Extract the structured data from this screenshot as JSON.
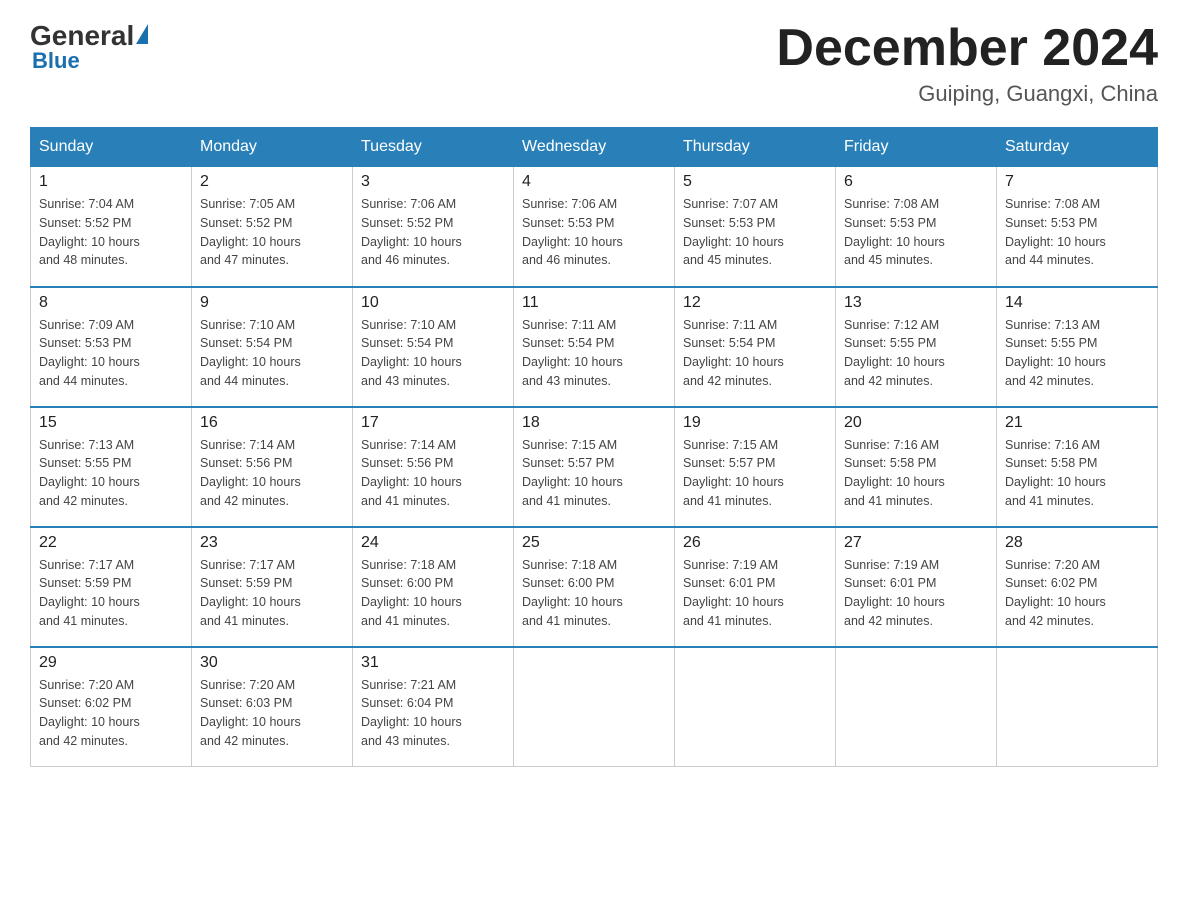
{
  "header": {
    "logo": {
      "general": "General",
      "blue": "Blue"
    },
    "title": "December 2024",
    "location": "Guiping, Guangxi, China"
  },
  "days_of_week": [
    "Sunday",
    "Monday",
    "Tuesday",
    "Wednesday",
    "Thursday",
    "Friday",
    "Saturday"
  ],
  "weeks": [
    [
      {
        "day": 1,
        "sunrise": "7:04 AM",
        "sunset": "5:52 PM",
        "daylight": "10 hours and 48 minutes."
      },
      {
        "day": 2,
        "sunrise": "7:05 AM",
        "sunset": "5:52 PM",
        "daylight": "10 hours and 47 minutes."
      },
      {
        "day": 3,
        "sunrise": "7:06 AM",
        "sunset": "5:52 PM",
        "daylight": "10 hours and 46 minutes."
      },
      {
        "day": 4,
        "sunrise": "7:06 AM",
        "sunset": "5:53 PM",
        "daylight": "10 hours and 46 minutes."
      },
      {
        "day": 5,
        "sunrise": "7:07 AM",
        "sunset": "5:53 PM",
        "daylight": "10 hours and 45 minutes."
      },
      {
        "day": 6,
        "sunrise": "7:08 AM",
        "sunset": "5:53 PM",
        "daylight": "10 hours and 45 minutes."
      },
      {
        "day": 7,
        "sunrise": "7:08 AM",
        "sunset": "5:53 PM",
        "daylight": "10 hours and 44 minutes."
      }
    ],
    [
      {
        "day": 8,
        "sunrise": "7:09 AM",
        "sunset": "5:53 PM",
        "daylight": "10 hours and 44 minutes."
      },
      {
        "day": 9,
        "sunrise": "7:10 AM",
        "sunset": "5:54 PM",
        "daylight": "10 hours and 44 minutes."
      },
      {
        "day": 10,
        "sunrise": "7:10 AM",
        "sunset": "5:54 PM",
        "daylight": "10 hours and 43 minutes."
      },
      {
        "day": 11,
        "sunrise": "7:11 AM",
        "sunset": "5:54 PM",
        "daylight": "10 hours and 43 minutes."
      },
      {
        "day": 12,
        "sunrise": "7:11 AM",
        "sunset": "5:54 PM",
        "daylight": "10 hours and 42 minutes."
      },
      {
        "day": 13,
        "sunrise": "7:12 AM",
        "sunset": "5:55 PM",
        "daylight": "10 hours and 42 minutes."
      },
      {
        "day": 14,
        "sunrise": "7:13 AM",
        "sunset": "5:55 PM",
        "daylight": "10 hours and 42 minutes."
      }
    ],
    [
      {
        "day": 15,
        "sunrise": "7:13 AM",
        "sunset": "5:55 PM",
        "daylight": "10 hours and 42 minutes."
      },
      {
        "day": 16,
        "sunrise": "7:14 AM",
        "sunset": "5:56 PM",
        "daylight": "10 hours and 42 minutes."
      },
      {
        "day": 17,
        "sunrise": "7:14 AM",
        "sunset": "5:56 PM",
        "daylight": "10 hours and 41 minutes."
      },
      {
        "day": 18,
        "sunrise": "7:15 AM",
        "sunset": "5:57 PM",
        "daylight": "10 hours and 41 minutes."
      },
      {
        "day": 19,
        "sunrise": "7:15 AM",
        "sunset": "5:57 PM",
        "daylight": "10 hours and 41 minutes."
      },
      {
        "day": 20,
        "sunrise": "7:16 AM",
        "sunset": "5:58 PM",
        "daylight": "10 hours and 41 minutes."
      },
      {
        "day": 21,
        "sunrise": "7:16 AM",
        "sunset": "5:58 PM",
        "daylight": "10 hours and 41 minutes."
      }
    ],
    [
      {
        "day": 22,
        "sunrise": "7:17 AM",
        "sunset": "5:59 PM",
        "daylight": "10 hours and 41 minutes."
      },
      {
        "day": 23,
        "sunrise": "7:17 AM",
        "sunset": "5:59 PM",
        "daylight": "10 hours and 41 minutes."
      },
      {
        "day": 24,
        "sunrise": "7:18 AM",
        "sunset": "6:00 PM",
        "daylight": "10 hours and 41 minutes."
      },
      {
        "day": 25,
        "sunrise": "7:18 AM",
        "sunset": "6:00 PM",
        "daylight": "10 hours and 41 minutes."
      },
      {
        "day": 26,
        "sunrise": "7:19 AM",
        "sunset": "6:01 PM",
        "daylight": "10 hours and 41 minutes."
      },
      {
        "day": 27,
        "sunrise": "7:19 AM",
        "sunset": "6:01 PM",
        "daylight": "10 hours and 42 minutes."
      },
      {
        "day": 28,
        "sunrise": "7:20 AM",
        "sunset": "6:02 PM",
        "daylight": "10 hours and 42 minutes."
      }
    ],
    [
      {
        "day": 29,
        "sunrise": "7:20 AM",
        "sunset": "6:02 PM",
        "daylight": "10 hours and 42 minutes."
      },
      {
        "day": 30,
        "sunrise": "7:20 AM",
        "sunset": "6:03 PM",
        "daylight": "10 hours and 42 minutes."
      },
      {
        "day": 31,
        "sunrise": "7:21 AM",
        "sunset": "6:04 PM",
        "daylight": "10 hours and 43 minutes."
      },
      null,
      null,
      null,
      null
    ]
  ],
  "labels": {
    "sunrise": "Sunrise:",
    "sunset": "Sunset:",
    "daylight": "Daylight:"
  }
}
